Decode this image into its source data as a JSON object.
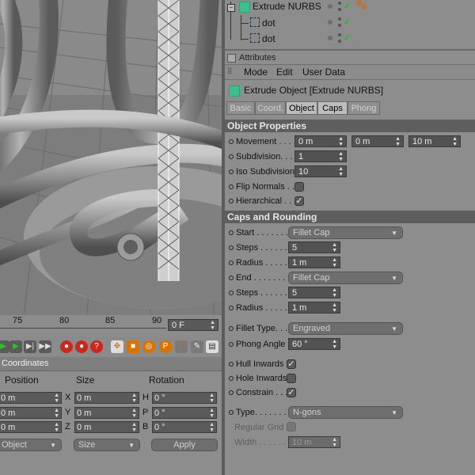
{
  "objects": [
    {
      "name": "Extrude NURBS",
      "icon": "extrude-nurbs-icon"
    },
    {
      "name": "dot",
      "icon": "spline-icon"
    },
    {
      "name": "dot",
      "icon": "spline-icon"
    }
  ],
  "attributes": {
    "title": "Attributes",
    "menu": [
      "Mode",
      "Edit",
      "User Data"
    ],
    "object_title": "Extrude Object [Extrude NURBS]",
    "tabs": [
      "Basic",
      "Coord.",
      "Object",
      "Caps",
      "Phong"
    ],
    "active_tabs": [
      "Object",
      "Caps"
    ]
  },
  "object_properties": {
    "section": "Object Properties",
    "movement_label": "Movement . . .",
    "movement": [
      "0 m",
      "0 m",
      "10 m"
    ],
    "subdivision_label": "Subdivision. . .",
    "subdivision": "1",
    "iso_label": "Iso Subdivision",
    "iso": "10",
    "flip_label": "Flip Normals . .",
    "flip": false,
    "hier_label": "Hierarchical . .",
    "hier": true
  },
  "caps": {
    "section": "Caps and Rounding",
    "start_label": "Start . . . . . . .",
    "start": "Fillet Cap",
    "steps1_label": "Steps . . . . . .",
    "steps1": "5",
    "radius1_label": "Radius . . . . .",
    "radius1": "1 m",
    "end_label": "End . . . . . . . .",
    "end": "Fillet Cap",
    "steps2_label": "Steps . . . . . .",
    "steps2": "5",
    "radius2_label": "Radius . . . . .",
    "radius2": "1 m",
    "fillet_type_label": "Fillet Type. . .",
    "fillet_type": "Engraved",
    "phong_label": "Phong Angle",
    "phong": "60 °",
    "hull_label": "Hull Inwards",
    "hull": true,
    "hole_label": "Hole Inwards",
    "hole": false,
    "constrain_label": "Constrain . . .",
    "constrain": true,
    "type_label": "Type. . . . . . .",
    "type": "N-gons",
    "regular_grid_label": "Regular Grid",
    "regular_grid": false,
    "width_label": "Width . . . . . .",
    "width": "10 m"
  },
  "timeline": {
    "ticks": [
      "75",
      "80",
      "85",
      "90"
    ],
    "current_frame": "0 F"
  },
  "coordinates": {
    "title": "Coordinates",
    "headers": [
      "Position",
      "Size",
      "Rotation"
    ],
    "rows": [
      {
        "pos": "0 m",
        "size_axis": "X",
        "size": "0 m",
        "rot_axis": "H",
        "rot": "0 °"
      },
      {
        "pos": "0 m",
        "size_axis": "Y",
        "size": "0 m",
        "rot_axis": "P",
        "rot": "0 °"
      },
      {
        "pos": "0 m",
        "size_axis": "Z",
        "size": "0 m",
        "rot_axis": "B",
        "rot": "0 °"
      }
    ],
    "mode": "Object",
    "size_mode": "Size",
    "apply": "Apply"
  },
  "colors": {
    "accent_tab": "#bdbdbd",
    "section_bg": "#5e5e5e",
    "check_green": "#1dbb1d"
  }
}
